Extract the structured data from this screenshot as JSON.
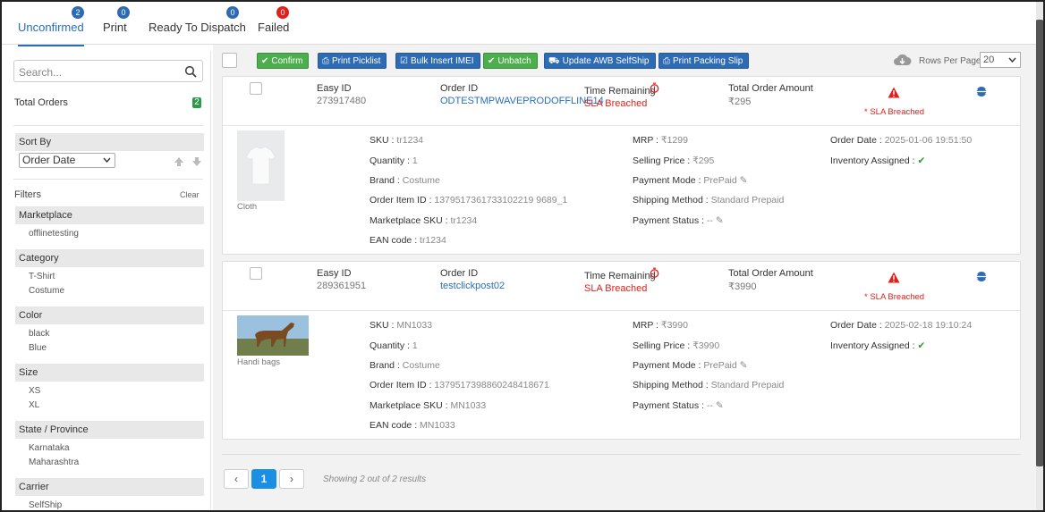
{
  "tabs": [
    {
      "label": "Unconfirmed",
      "count": "2",
      "color": "#2d6bb5"
    },
    {
      "label": "Print",
      "count": "0",
      "color": "#2d6bb5"
    },
    {
      "label": "Ready To Dispatch",
      "count": "0",
      "color": "#2d6bb5"
    },
    {
      "label": "Failed",
      "count": "0",
      "color": "#e0201a"
    }
  ],
  "sidebar": {
    "search_placeholder": "Search...",
    "total_orders_label": "Total Orders",
    "total_orders_count": "2",
    "sort_by_label": "Sort By",
    "sort_by_value": "Order Date",
    "filters_label": "Filters",
    "clear_label": "Clear",
    "sections": [
      {
        "title": "Marketplace",
        "items": [
          "offlinetesting"
        ]
      },
      {
        "title": "Category",
        "items": [
          "T-Shirt",
          "Costume"
        ]
      },
      {
        "title": "Color",
        "items": [
          "black",
          "Blue"
        ]
      },
      {
        "title": "Size",
        "items": [
          "XS",
          "XL"
        ]
      },
      {
        "title": "State / Province",
        "items": [
          "Karnataka",
          "Maharashtra"
        ]
      },
      {
        "title": "Carrier",
        "items": [
          "SelfShip"
        ]
      }
    ]
  },
  "toolbar": {
    "buttons": [
      "Confirm",
      "Print Picklist",
      "Bulk Insert IMEI",
      "Unbatch",
      "Update AWB SelfShip",
      "Print Packing Slip"
    ],
    "rows_per_page_label": "Rows Per Page",
    "rows_per_page_value": "20"
  },
  "labels": {
    "easy_id": "Easy ID",
    "order_id": "Order ID",
    "time_remaining": "Time Remaining",
    "total_order_amount": "Total Order Amount",
    "sku": "SKU :",
    "quantity": "Quantity :",
    "brand": "Brand :",
    "order_item_id": "Order Item ID :",
    "marketplace_sku": "Marketplace SKU :",
    "ean_code": "EAN code :",
    "mrp": "MRP :",
    "selling_price": "Selling Price :",
    "payment_mode": "Payment Mode :",
    "shipping_method": "Shipping Method :",
    "payment_status": "Payment Status :",
    "order_date": "Order Date :",
    "inventory_assigned": "Inventory Assigned :"
  },
  "orders": [
    {
      "easy_id": "273917480",
      "order_id": "ODTESTMPWAVEPRODOFFLINE14",
      "sla": "SLA Breached",
      "amount": "₹295",
      "sla_note": "* SLA Breached",
      "product_label": "Cloth",
      "sku": "tr1234",
      "quantity": "1",
      "brand": "Costume",
      "order_item_id": "1379517361733102219 9689_1",
      "marketplace_sku": "tr1234",
      "ean": "tr1234",
      "mrp": "₹1299",
      "selling_price": "₹295",
      "payment_mode": "PrePaid",
      "shipping_method": "Standard Prepaid",
      "payment_status": "--",
      "order_date": "2025-01-06 19:51:50"
    },
    {
      "easy_id": "289361951",
      "order_id": "testclickpost02",
      "sla": "SLA Breached",
      "amount": "₹3990",
      "sla_note": "* SLA Breached",
      "product_label": "Handi bags",
      "sku": "MN1033",
      "quantity": "1",
      "brand": "Costume",
      "order_item_id": "1379517398860248418671",
      "marketplace_sku": "MN1033",
      "ean": "MN1033",
      "mrp": "₹3990",
      "selling_price": "₹3990",
      "payment_mode": "PrePaid",
      "shipping_method": "Standard Prepaid",
      "payment_status": "--",
      "order_date": "2025-02-18 19:10:24"
    }
  ],
  "pagination": {
    "prev": "‹",
    "page": "1",
    "next": "›",
    "summary": "Showing 2 out of 2 results"
  }
}
